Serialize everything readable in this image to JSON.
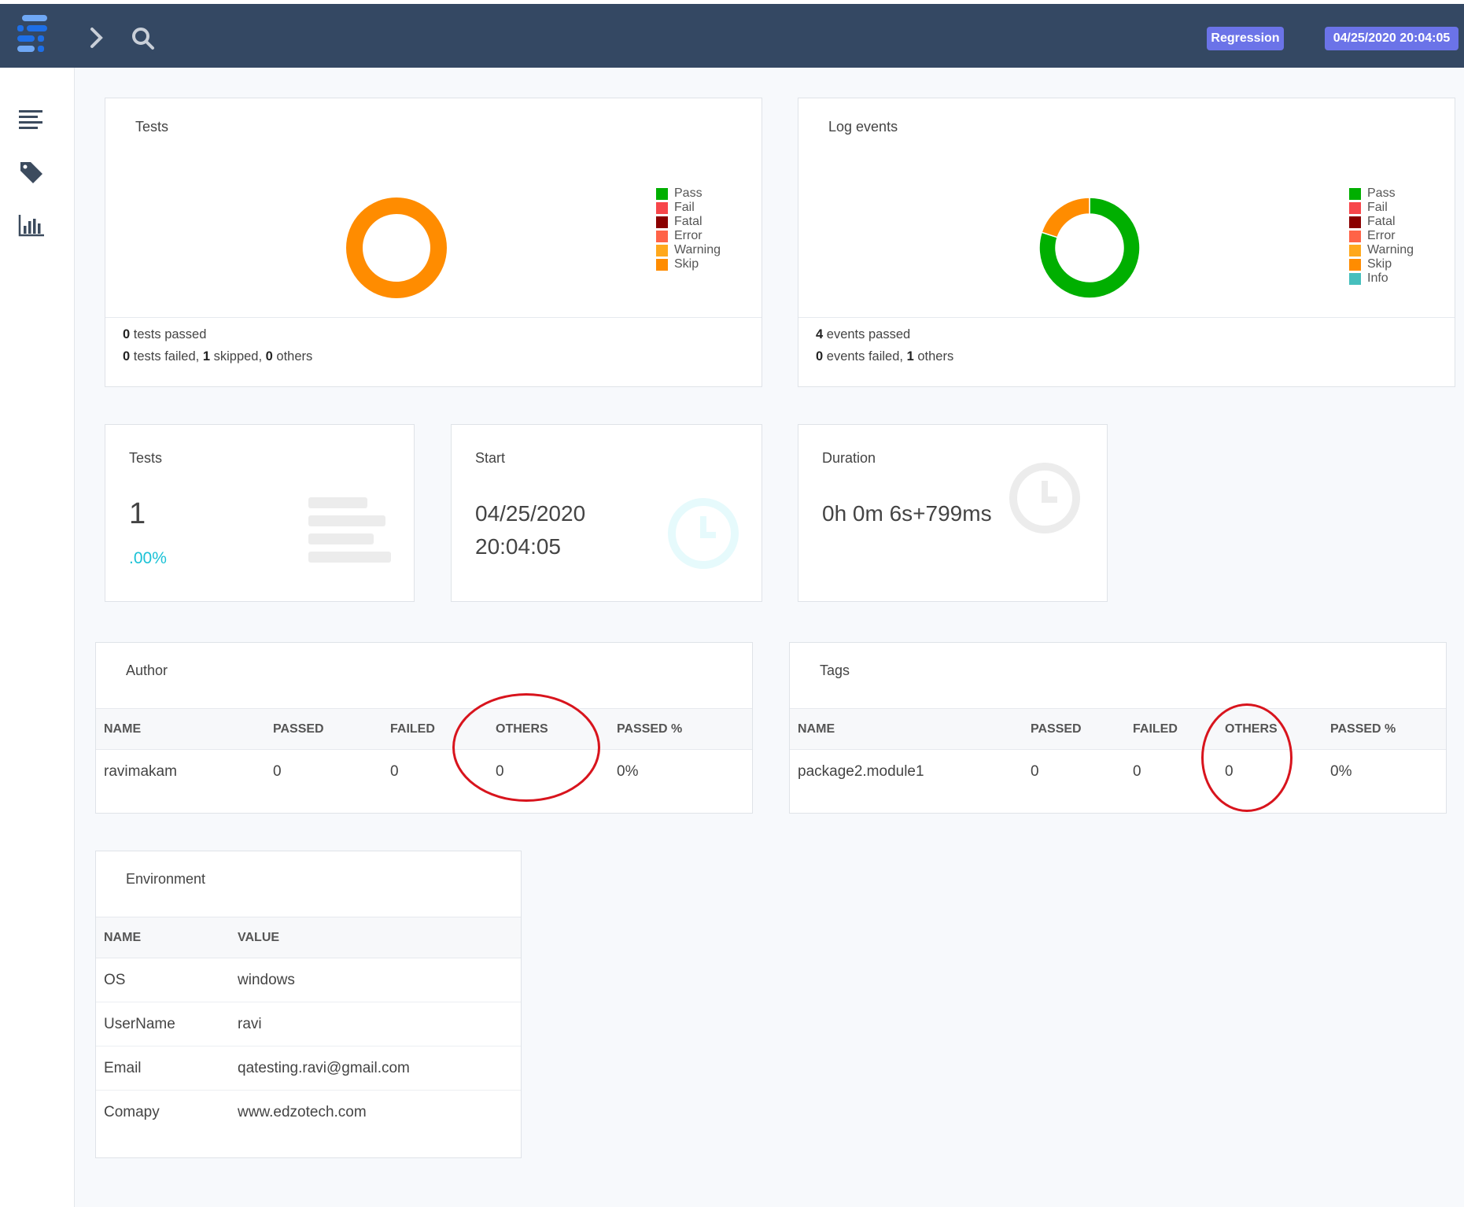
{
  "header": {
    "badge_suite": "Regression",
    "badge_datetime": "04/25/2020 20:04:05",
    "icons": [
      "extent-logo",
      "chevron-right-icon",
      "search-icon"
    ]
  },
  "sidebar": {
    "icons": [
      "list-icon",
      "tag-icon",
      "bar-chart-icon"
    ]
  },
  "tests_chart": {
    "title": "Tests",
    "legend": [
      {
        "label": "Pass",
        "color": "#00af00"
      },
      {
        "label": "Fail",
        "color": "#f7464a"
      },
      {
        "label": "Fatal",
        "color": "#8b0000"
      },
      {
        "label": "Error",
        "color": "#ff6347"
      },
      {
        "label": "Warning",
        "color": "#ffa81c"
      },
      {
        "label": "Skip",
        "color": "#ff8c00"
      }
    ],
    "summary_line1": {
      "n1": "0",
      "t1": " tests passed"
    },
    "summary_line2": {
      "n1": "0",
      "t1": " tests failed, ",
      "n2": "1",
      "t2": " skipped, ",
      "n3": "0",
      "t3": " others"
    }
  },
  "events_chart": {
    "title": "Log events",
    "legend": [
      {
        "label": "Pass",
        "color": "#00af00"
      },
      {
        "label": "Fail",
        "color": "#f7464a"
      },
      {
        "label": "Fatal",
        "color": "#8b0000"
      },
      {
        "label": "Error",
        "color": "#ff6347"
      },
      {
        "label": "Warning",
        "color": "#ffa81c"
      },
      {
        "label": "Skip",
        "color": "#ff8c00"
      },
      {
        "label": "Info",
        "color": "#46bfbd"
      }
    ],
    "summary_line1": {
      "n1": "4",
      "t1": " events passed"
    },
    "summary_line2": {
      "n1": "0",
      "t1": " events failed, ",
      "n2": "1",
      "t2": " others"
    }
  },
  "chart_data": [
    {
      "type": "pie",
      "title": "Tests",
      "categories": [
        "Pass",
        "Fail",
        "Fatal",
        "Error",
        "Warning",
        "Skip"
      ],
      "values": [
        0,
        0,
        0,
        0,
        0,
        1
      ],
      "colors": [
        "#00af00",
        "#f7464a",
        "#8b0000",
        "#ff6347",
        "#ffa81c",
        "#ff8c00"
      ],
      "donut": true,
      "legend": "right"
    },
    {
      "type": "pie",
      "title": "Log events",
      "categories": [
        "Pass",
        "Fail",
        "Fatal",
        "Error",
        "Warning",
        "Skip",
        "Info"
      ],
      "values": [
        4,
        0,
        0,
        0,
        0,
        1,
        0
      ],
      "colors": [
        "#00af00",
        "#f7464a",
        "#8b0000",
        "#ff6347",
        "#ffa81c",
        "#ff8c00",
        "#46bfbd"
      ],
      "donut": true,
      "legend": "right"
    }
  ],
  "stats": {
    "tests": {
      "title": "Tests",
      "value": "1",
      "percent": ".00%"
    },
    "start": {
      "title": "Start",
      "date": "04/25/2020",
      "time": "20:04:05"
    },
    "duration": {
      "title": "Duration",
      "value": "0h 0m 6s+799ms"
    }
  },
  "author": {
    "title": "Author",
    "columns": [
      "NAME",
      "PASSED",
      "FAILED",
      "OTHERS",
      "PASSED %"
    ],
    "rows": [
      [
        "ravimakam",
        "0",
        "0",
        "0",
        "0%"
      ]
    ]
  },
  "tags": {
    "title": "Tags",
    "columns": [
      "NAME",
      "PASSED",
      "FAILED",
      "OTHERS",
      "PASSED %"
    ],
    "rows": [
      [
        "package2.module1",
        "0",
        "0",
        "0",
        "0%"
      ]
    ]
  },
  "environment": {
    "title": "Environment",
    "columns": [
      "NAME",
      "VALUE"
    ],
    "rows": [
      [
        "OS",
        "windows"
      ],
      [
        "UserName",
        "ravi"
      ],
      [
        "Email",
        "qatesting.ravi@gmail.com"
      ],
      [
        "Comapy",
        "www.edzotech.com"
      ]
    ]
  },
  "annotation_color": "#d8141d"
}
